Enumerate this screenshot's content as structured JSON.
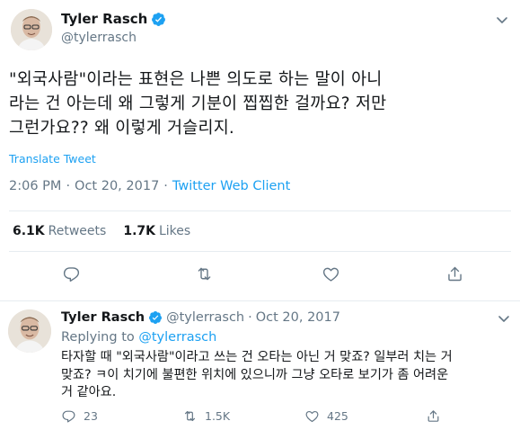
{
  "tweet": {
    "author_name": "Tyler Rasch",
    "author_handle": "@tylerrasch",
    "text": "\"외국사람\"이라는 표현은 나쁜 의도로 하는 말이 아니\n라는 건 아는데 왜 그렇게 기분이 찝찝한 걸까요? 저만\n그런가요?? 왜 이렇게 거슬리지.",
    "translate_label": "Translate Tweet",
    "time": "2:06 PM",
    "separator": "·",
    "date": "Oct 20, 2017",
    "client": "Twitter Web Client",
    "retweets_count": "6.1K",
    "retweets_label": "Retweets",
    "likes_count": "1.7K",
    "likes_label": "Likes"
  },
  "reply": {
    "author_name": "Tyler Rasch",
    "author_handle": "@tylerrasch",
    "separator": "·",
    "date": "Oct 20, 2017",
    "replying_prefix": "Replying to",
    "replying_to": "@tylerrasch",
    "text": "타자할 때 \"외국사람\"이라고 쓰는 건 오타는 아닌 거 맞죠? 일부러 치는 거\n맞죠? ㅋ이 치기에 불편한 위치에 있으니까 그냥 오타로 보기가 좀 어려운\n거 같아요.",
    "reply_count": "23",
    "retweet_count": "1.5K",
    "like_count": "425"
  },
  "icons": {
    "verified": "verified-badge-icon",
    "chevron": "chevron-down-icon",
    "reply": "reply-icon",
    "retweet": "retweet-icon",
    "like": "heart-icon",
    "share": "share-icon"
  },
  "colors": {
    "accent": "#1da1f2",
    "secondary_text": "#657786",
    "primary_text": "#14171a",
    "border": "#e6ecf0"
  }
}
